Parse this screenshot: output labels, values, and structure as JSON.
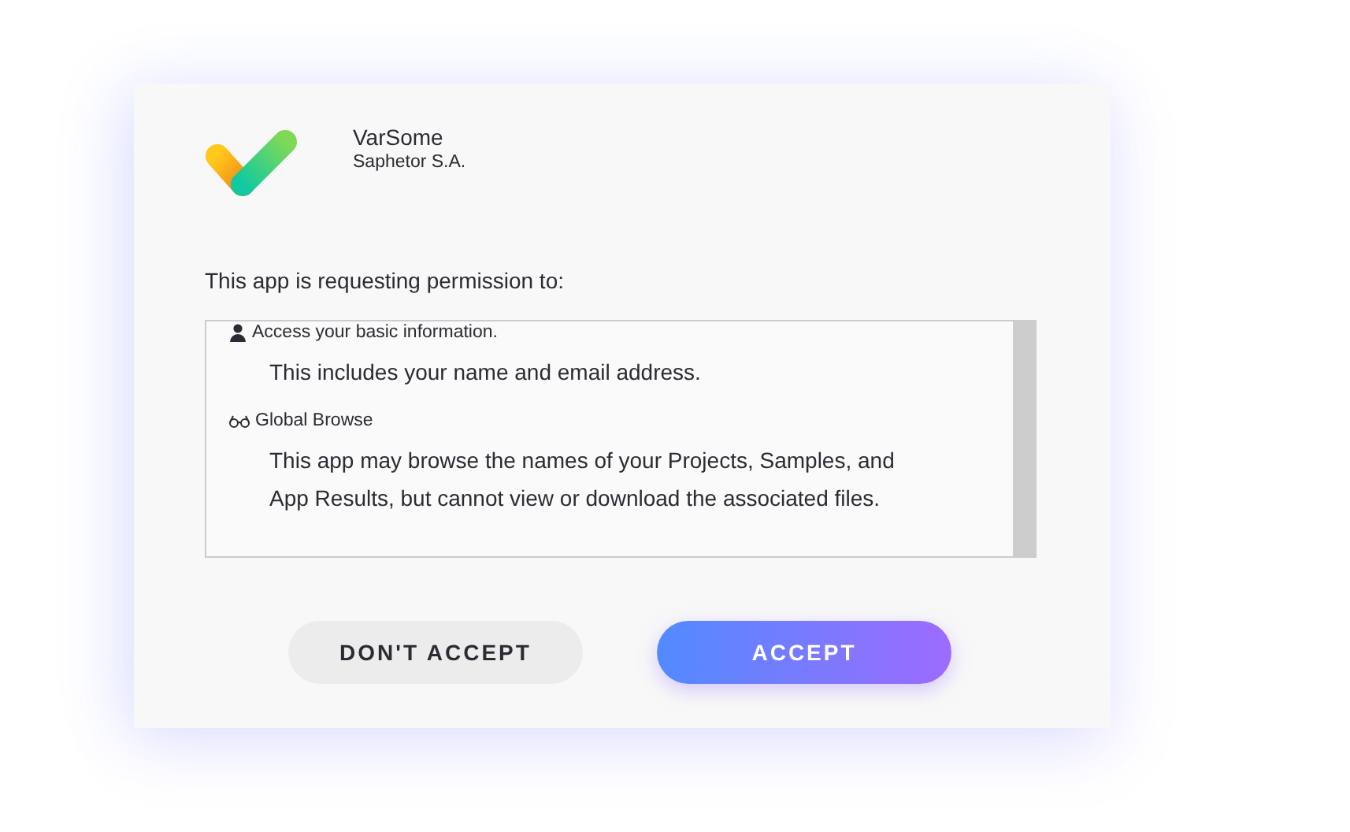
{
  "app": {
    "name": "VarSome",
    "publisher": "Saphetor S.A."
  },
  "request_text": "This app is requesting permission to:",
  "permissions": [
    {
      "kind": "person",
      "title": "Access your basic information.",
      "description": "This includes your name and email address."
    },
    {
      "kind": "glasses",
      "title": "Global Browse",
      "description": "This app may browse the names of your Projects, Samples, and App Results, but cannot view or download the associated files."
    }
  ],
  "buttons": [
    {
      "kind": "secondary",
      "label": "DON'T ACCEPT"
    },
    {
      "kind": "primary",
      "label": "ACCEPT"
    }
  ]
}
